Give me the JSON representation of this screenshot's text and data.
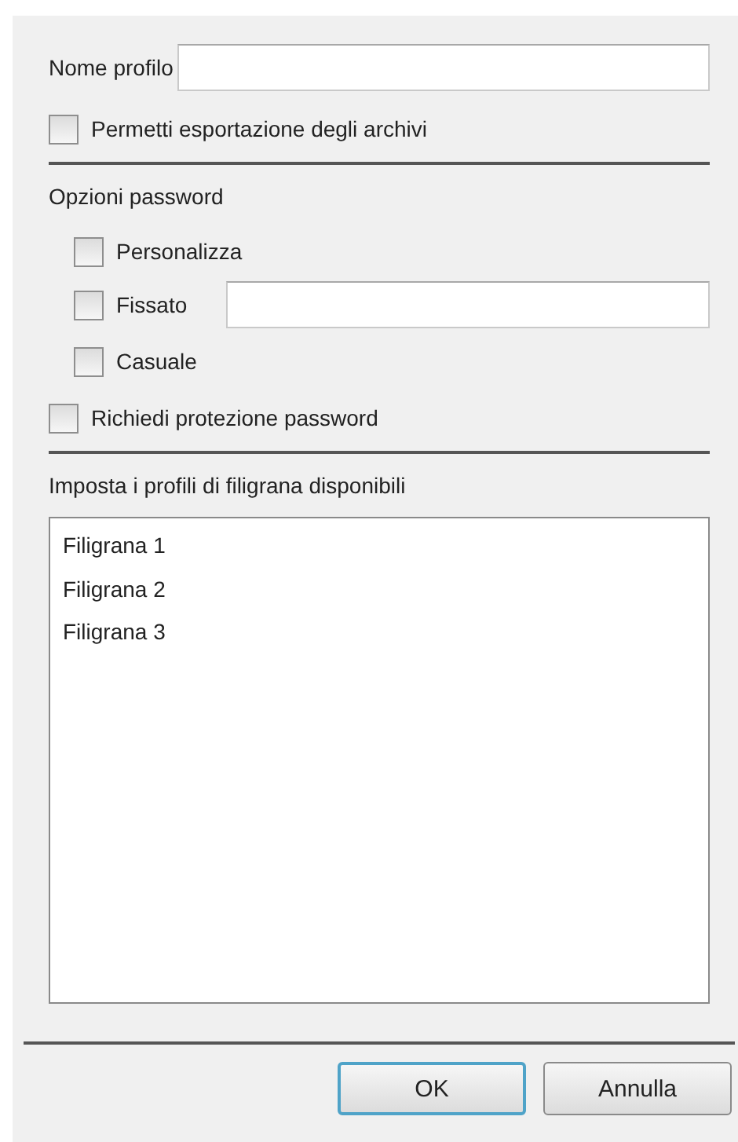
{
  "profile_name": {
    "label": "Nome profilo"
  },
  "allow_export": {
    "label": "Permetti esportazione degli archivi",
    "checked": false
  },
  "password_options": {
    "title": "Opzioni password",
    "options": [
      {
        "kind": "checkbox",
        "label": "Personalizza",
        "checked": false
      },
      {
        "kind": "checkbox-field",
        "label": "Fissato",
        "checked": false
      },
      {
        "kind": "checkbox",
        "label": "Casuale",
        "checked": false
      }
    ]
  },
  "require_protection": {
    "label": "Richiedi protezione password",
    "checked": false
  },
  "watermark_profiles": {
    "title": "Imposta i profili di filigrana disponibili",
    "items": [
      {
        "label": "Filigrana 1",
        "selected": false
      },
      {
        "label": "Filigrana 2",
        "selected": false
      },
      {
        "label": "Filigrana 3",
        "selected": false
      }
    ]
  },
  "buttons": [
    {
      "label": "OK",
      "default": true
    },
    {
      "label": "Annulla",
      "default": false
    }
  ]
}
